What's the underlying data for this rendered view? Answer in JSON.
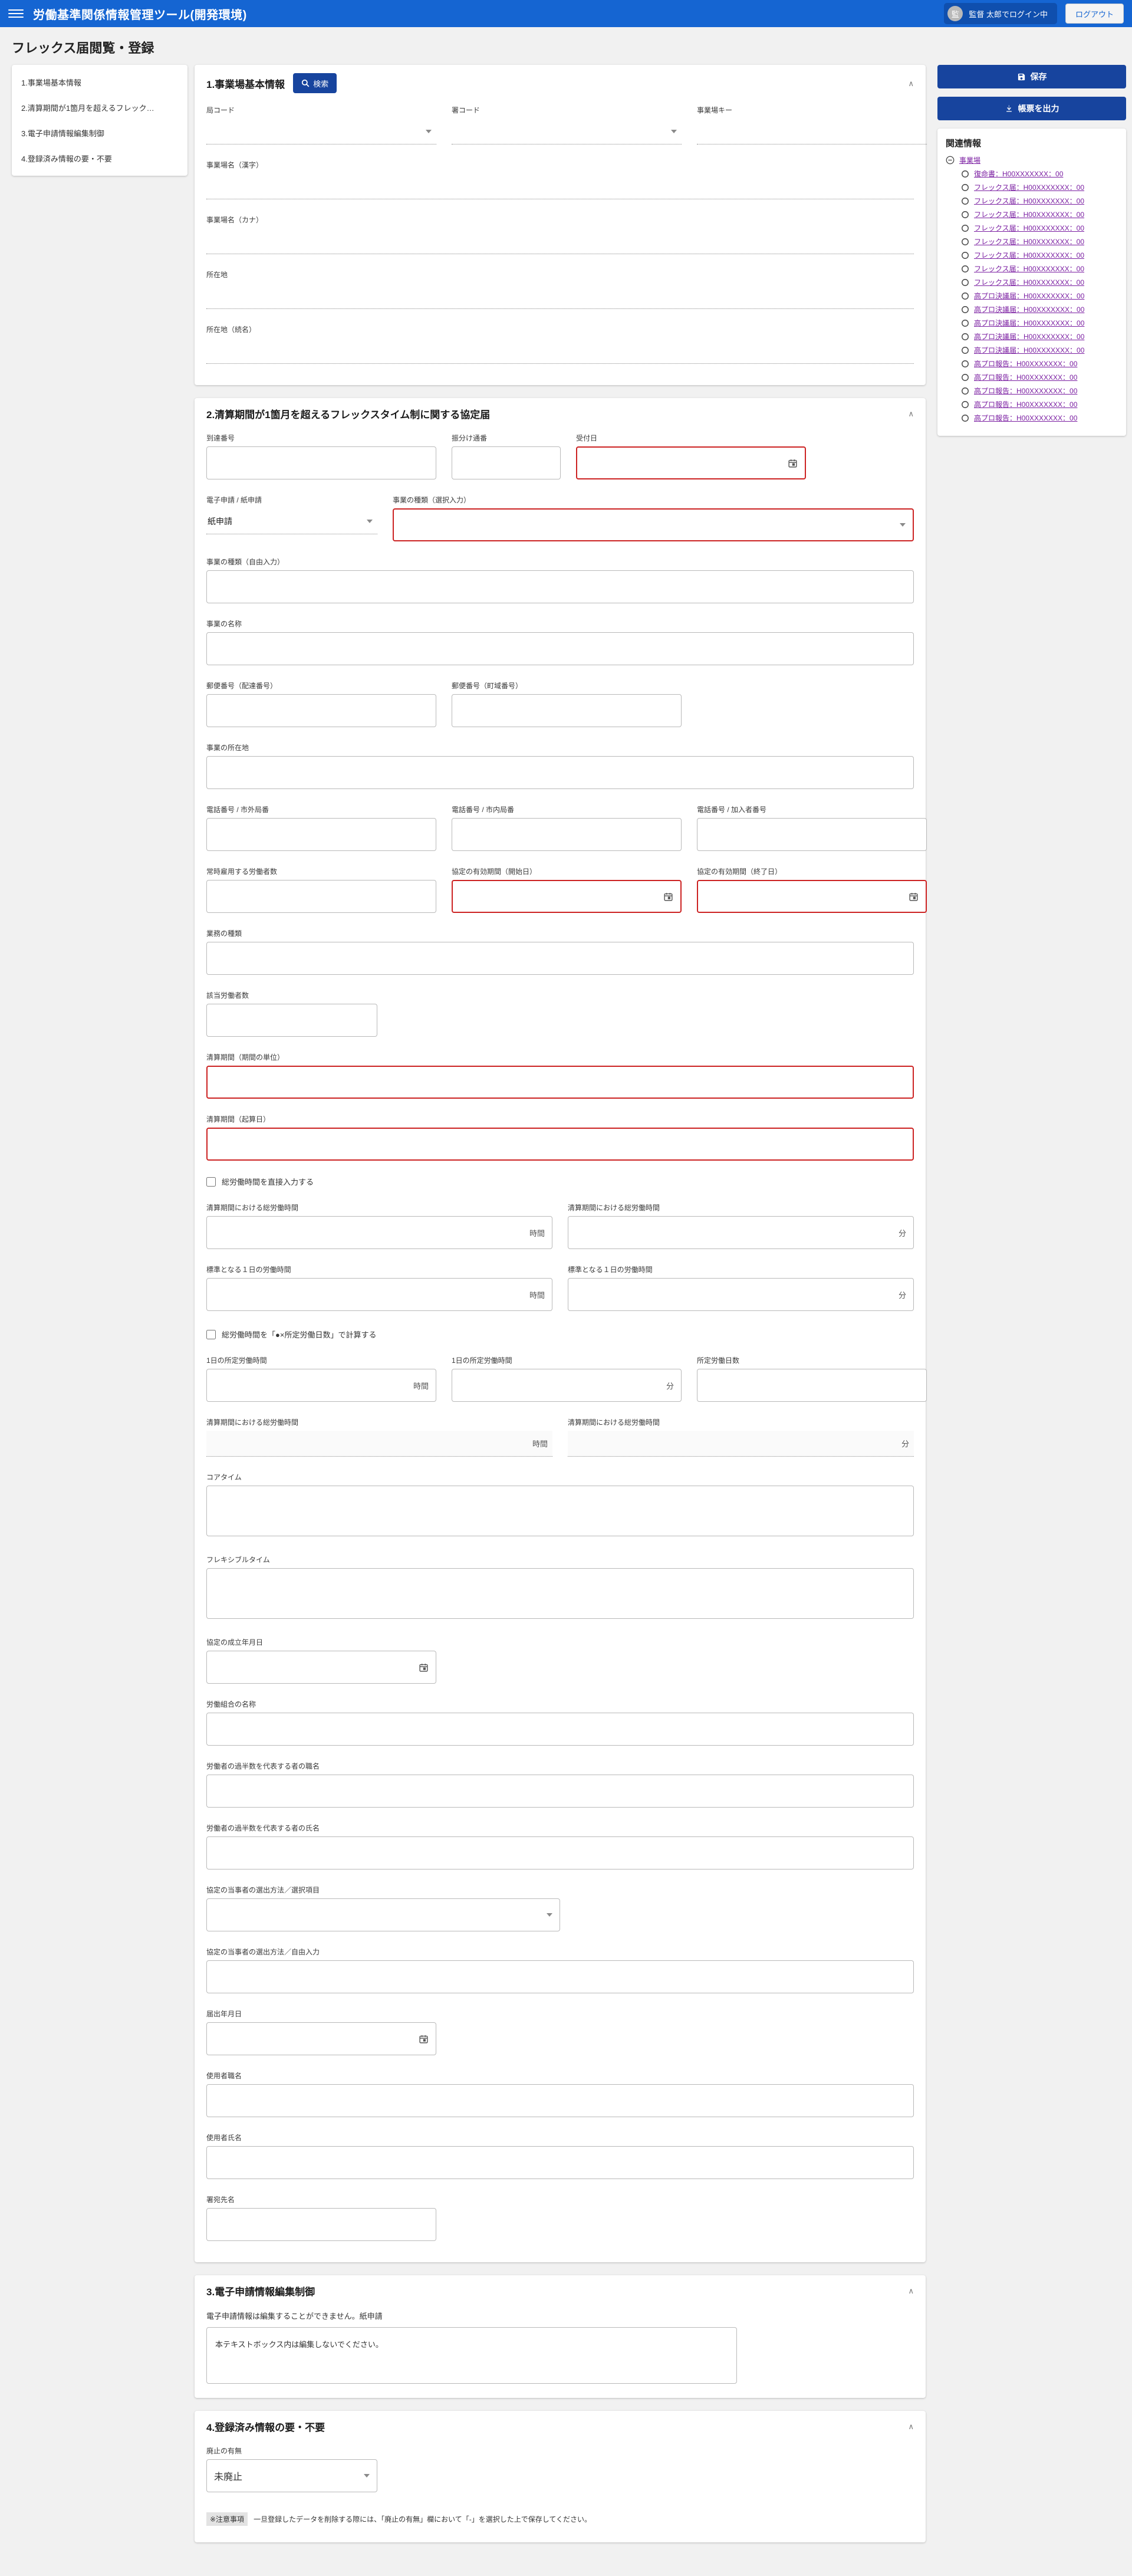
{
  "header": {
    "app_title": "労働基準関係情報管理ツール(開発環境)",
    "user_avatar": "監",
    "user_label": "監督 太郎でログイン中",
    "logout_label": "ログアウト"
  },
  "page": {
    "title": "フレックス届閲覧・登録"
  },
  "nav": {
    "items": [
      "1.事業場基本情報",
      "2.清算期間が1箇月を超えるフレック…",
      "3.電子申請情報編集制御",
      "4.登録済み情報の要・不要"
    ]
  },
  "actions": {
    "save_label": "保存",
    "export_label": "帳票を出力"
  },
  "related": {
    "title": "関連情報",
    "root": "事業場",
    "items": [
      "復命書：H00XXXXXXX：00",
      "フレックス届：H00XXXXXXX：00",
      "フレックス届：H00XXXXXXX：00",
      "フレックス届：H00XXXXXXX：00",
      "フレックス届：H00XXXXXXX：00",
      "フレックス届：H00XXXXXXX：00",
      "フレックス届：H00XXXXXXX：00",
      "フレックス届：H00XXXXXXX：00",
      "フレックス届：H00XXXXXXX：00",
      "高プロ決議届：H00XXXXXXX：00",
      "高プロ決議届：H00XXXXXXX：00",
      "高プロ決議届：H00XXXXXXX：00",
      "高プロ決議届：H00XXXXXXX：00",
      "高プロ決議届：H00XXXXXXX：00",
      "高プロ報告：H00XXXXXXX：00",
      "高プロ報告：H00XXXXXXX：00",
      "高プロ報告：H00XXXXXXX：00",
      "高プロ報告：H00XXXXXXX：00",
      "高プロ報告：H00XXXXXXX：00"
    ]
  },
  "section1": {
    "title": "1.事業場基本情報",
    "search_label": "検索",
    "kyoku_label": "局コード",
    "sho_label": "署コード",
    "key_label": "事業場キー",
    "name_kanji_label": "事業場名（漢字）",
    "name_kana_label": "事業場名（カナ）",
    "address_label": "所在地",
    "address2_label": "所在地（続名）"
  },
  "section2": {
    "title": "2.清算期間が1箇月を超えるフレックスタイム制に関する協定届",
    "todatsu_label": "到達番号",
    "furiwake_label": "振分け通番",
    "uketsuke_label": "受付日",
    "denshi_label": "電子申請 / 紙申請",
    "denshi_value": "紙申請",
    "shurui_select_label": "事業の種類（選択入力）",
    "shurui_free_label": "事業の種類（自由入力）",
    "jigyo_name_label": "事業の名称",
    "yubin1_label": "郵便番号（配達番号）",
    "yubin2_label": "郵便番号（町域番号）",
    "shozaichi_label": "事業の所在地",
    "tel1_label": "電話番号 / 市外局番",
    "tel2_label": "電話番号 / 市内局番",
    "tel3_label": "電話番号 / 加入者番号",
    "joji_label": "常時雇用する労働者数",
    "yuko_start_label": "協定の有効期間（開始日）",
    "yuko_end_label": "協定の有効期間（終了日）",
    "gyomu_label": "業務の種類",
    "gaito_label": "該当労働者数",
    "seisan_unit_label": "清算期間（期間の単位）",
    "seisan_kisan_label": "清算期間（起算日）",
    "cb_direct_label": "総労働時間を直接入力する",
    "soro_label": "清算期間における総労働時間",
    "hyojun_label": "標準となる１日の労働時間",
    "cb_calc_label": "総労働時間を「●×所定労働日数」で計算する",
    "shotei_label": "1日の所定労働時間",
    "shotei_days_label": "所定労働日数",
    "unit_hour": "時間",
    "unit_min": "分",
    "core_label": "コアタイム",
    "flex_label": "フレキシブルタイム",
    "seiritsu_label": "協定の成立年月日",
    "kumiai_label": "労働組合の名称",
    "kahansu_shoku_label": "労働者の過半数を代表する者の職名",
    "kahansu_shimei_label": "労働者の過半数を代表する者の氏名",
    "sensyutu_select_label": "協定の当事者の選出方法／選択項目",
    "sensyutu_free_label": "協定の当事者の選出方法／自由入力",
    "todokede_label": "届出年月日",
    "shiyosha_shoku_label": "使用者職名",
    "shiyosha_shimei_label": "使用者氏名",
    "sho_atesaki_label": "署宛先名"
  },
  "section3": {
    "title": "3.電子申請情報編集制御",
    "note": "電子申請情報は編集することができません。紙申請",
    "box_text": "本テキストボックス内は編集しないでください。"
  },
  "section4": {
    "title": "4.登録済み情報の要・不要",
    "haishi_label": "廃止の有無",
    "haishi_value": "未廃止",
    "notice_badge": "※注意事項",
    "notice_text": "一旦登録したデータを削除する際には、「廃止の有無」欄において「-」を選択した上で保存してください。"
  }
}
